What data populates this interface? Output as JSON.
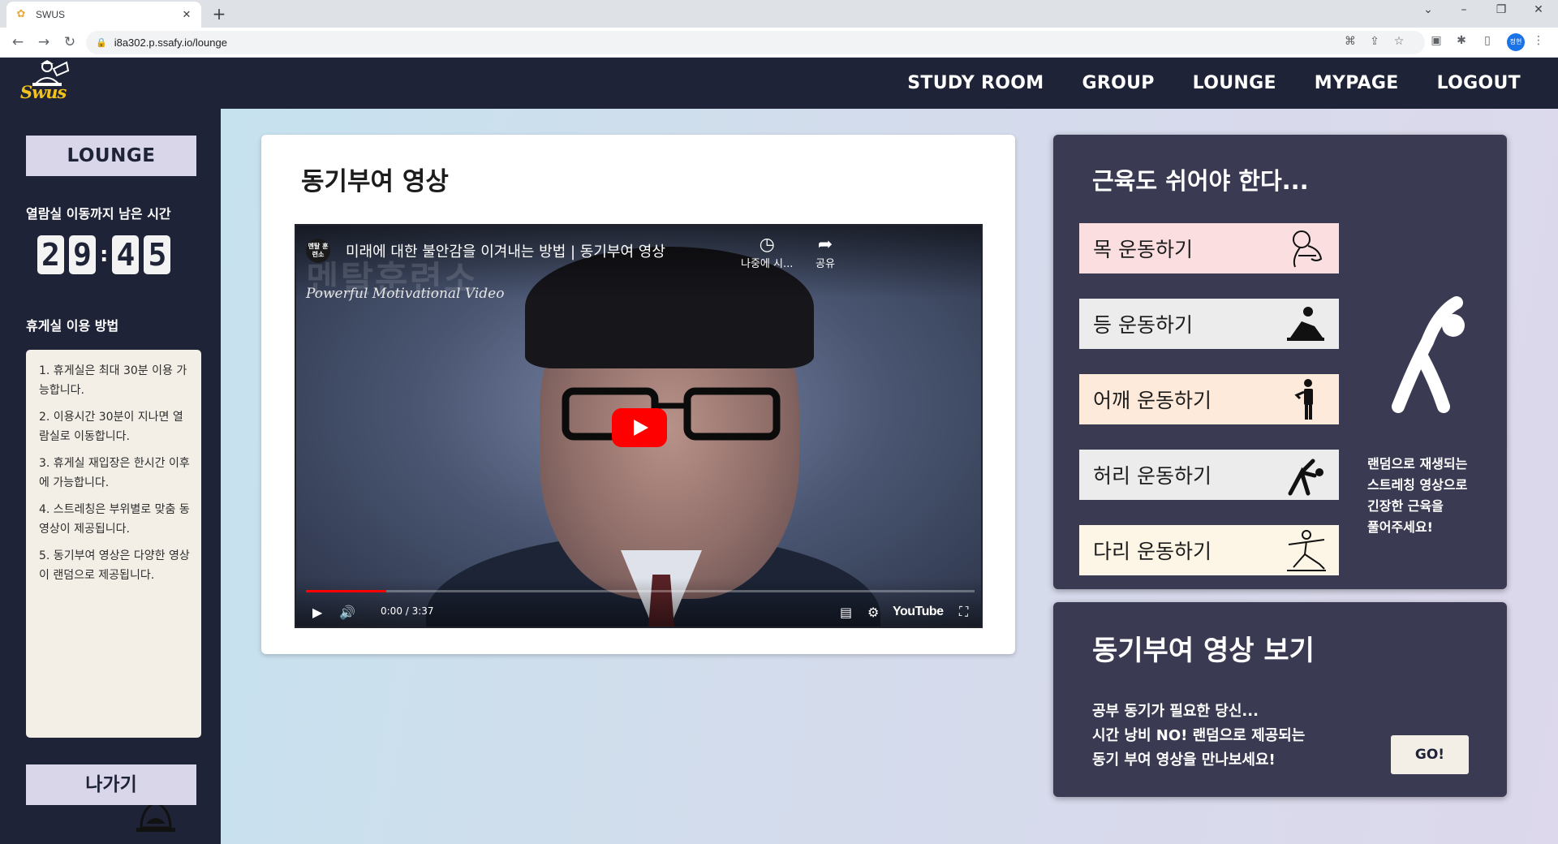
{
  "browser": {
    "tab_title": "SWUS",
    "url": "i8a302.p.ssafy.io/lounge",
    "profile_label": "정현"
  },
  "header": {
    "logo_text": "Swus",
    "nav": [
      "STUDY ROOM",
      "GROUP",
      "LOUNGE",
      "MYPAGE",
      "LOGOUT"
    ]
  },
  "sidebar": {
    "title": "LOUNGE",
    "timer_label": "열람실 이동까지 남은 시간",
    "timer_digits": [
      "2",
      "9",
      "4",
      "5"
    ],
    "guide_label": "휴게실 이용 방법",
    "guide_items": [
      "1. 휴게실은 최대 30분 이용 가능합니다.",
      "2. 이용시간 30분이 지나면 열람실로 이동합니다.",
      "3. 휴게실 재입장은 한시간 이후에 가능합니다.",
      "4. 스트레칭은 부위별로 맞춤 동영상이 제공됩니다.",
      "5. 동기부여 영상은 다양한 영상이 랜덤으로 제공됩니다."
    ],
    "exit_label": "나가기"
  },
  "video_card": {
    "title": "동기부여 영상",
    "player": {
      "channel_badge": "멘탈 훈련소",
      "video_title": "미래에 대한 불안감을 이겨내는 방법 | 동기부여 영상",
      "watermark": "멘탈훈련소",
      "subtitle": "Powerful Motivational Video",
      "watch_later": "나중에 시...",
      "share": "공유",
      "time": "0:00 / 3:37",
      "brand": "YouTube",
      "progress_fraction": 0.12
    }
  },
  "stretch_card": {
    "title": "근육도 쉬어야 한다...",
    "buttons": [
      {
        "label": "목 운동하기",
        "icon": "neck-stretch-icon",
        "color": "#fbdfe0"
      },
      {
        "label": "등 운동하기",
        "icon": "back-stretch-icon",
        "color": "#ececec"
      },
      {
        "label": "어깨 운동하기",
        "icon": "shoulder-stretch-icon",
        "color": "#fdeadb"
      },
      {
        "label": "허리 운동하기",
        "icon": "waist-stretch-icon",
        "color": "#ececec"
      },
      {
        "label": "다리 운동하기",
        "icon": "leg-stretch-icon",
        "color": "#fdf6e6"
      }
    ],
    "desc_lines": [
      "랜덤으로 재생되는",
      "스트레칭 영상으로",
      "긴장한 근육을",
      "풀어주세요!"
    ]
  },
  "motiv_card": {
    "title": "동기부여 영상 보기",
    "desc_lines": [
      "공부 동기가 필요한 당신...",
      "시간 낭비 NO! 랜덤으로 제공되는",
      "동기 부여 영상을 만나보세요!"
    ],
    "go_label": "GO!"
  },
  "colors": {
    "navy": "#1e2337",
    "card_dark": "#3a3b52",
    "lavender": "#d9d6e9",
    "logo_yellow": "#f2c21b",
    "youtube_red": "#ff0000"
  }
}
